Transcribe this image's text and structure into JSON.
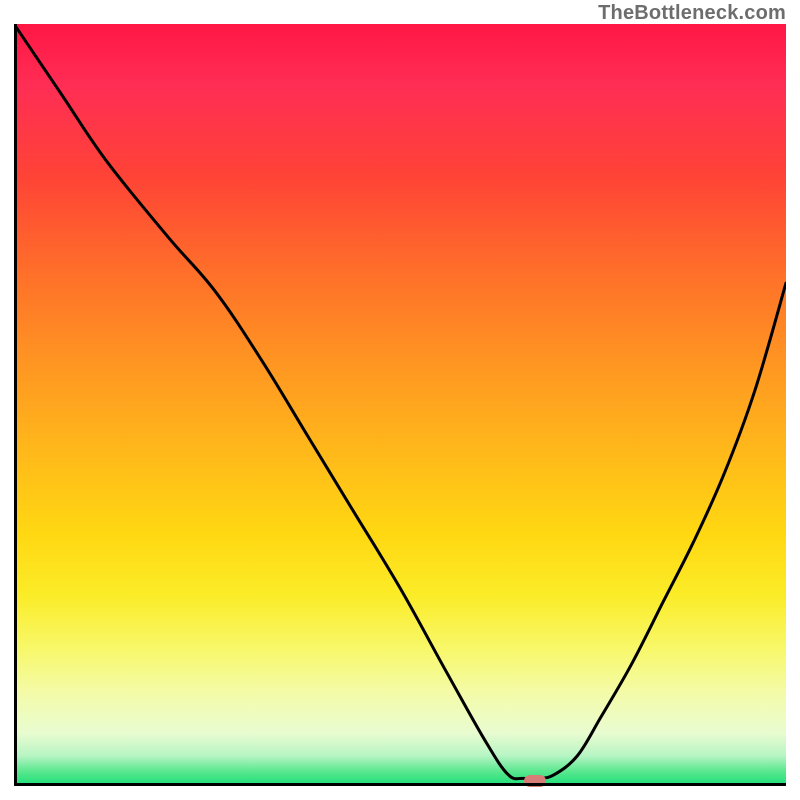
{
  "watermark": {
    "text": "TheBottleneck.com"
  },
  "marker": {
    "x_pct": 67.5,
    "y_pct": 99.3,
    "color": "#d77d77"
  },
  "curve": {
    "stroke": "#000000",
    "stroke_width": 3
  },
  "chart_data": {
    "type": "line",
    "title": "",
    "xlabel": "",
    "ylabel": "",
    "xlim": [
      0,
      100
    ],
    "ylim": [
      0,
      100
    ],
    "x": [
      0,
      6,
      12,
      20,
      26,
      32,
      38,
      44,
      50,
      56,
      61,
      64,
      66,
      68,
      70,
      73,
      76,
      80,
      84,
      88,
      92,
      96,
      100
    ],
    "values": [
      100,
      91,
      82,
      72,
      65,
      56,
      46,
      36,
      26,
      15,
      6,
      1.5,
      1,
      1,
      1.5,
      4,
      9,
      16,
      24,
      32,
      41,
      52,
      66
    ],
    "marker_point": {
      "x": 67.5,
      "y": 0.7
    },
    "annotations": []
  }
}
